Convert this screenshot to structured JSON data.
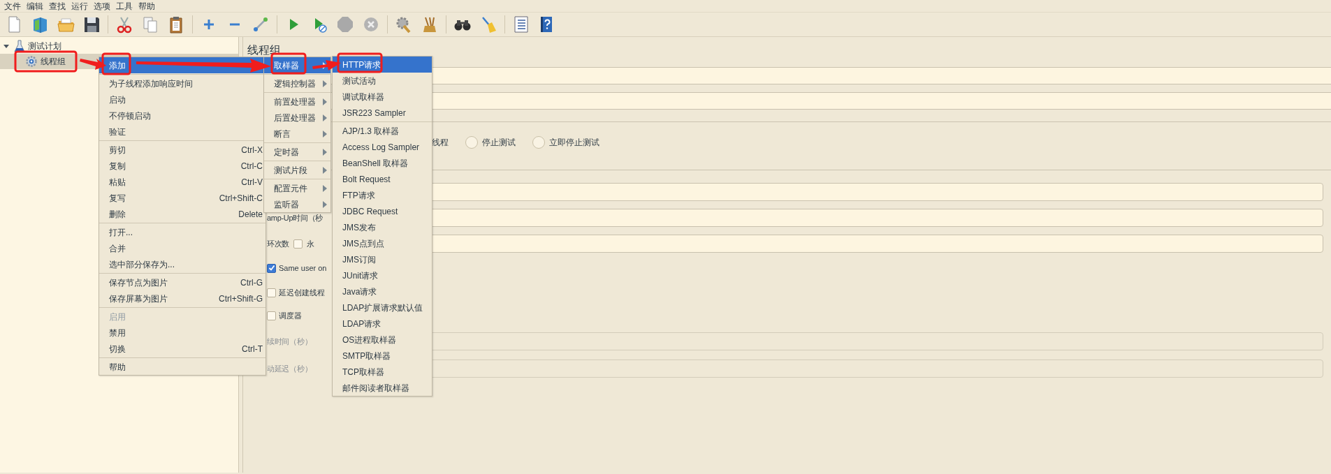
{
  "menubar": [
    {
      "label": "文件"
    },
    {
      "label": "编辑"
    },
    {
      "label": "查找"
    },
    {
      "label": "运行"
    },
    {
      "label": "选项"
    },
    {
      "label": "工具"
    },
    {
      "label": "帮助"
    }
  ],
  "tree": [
    {
      "label": "测试计划",
      "expanded": true,
      "selected": false,
      "children": [
        {
          "label": "线程组",
          "selected": true
        }
      ]
    }
  ],
  "panel": {
    "title": "线程组",
    "rows": [
      {
        "kind": "wide_field"
      },
      {
        "kind": "wide_field"
      },
      {
        "kind": "radios",
        "lead": "线程",
        "options": [
          {
            "label": "停止测试",
            "selected": false
          },
          {
            "label": "立即停止测试",
            "selected": false
          }
        ]
      },
      {
        "kind": "field"
      },
      {
        "kind": "field",
        "label": "amp-Up时间（秒"
      },
      {
        "kind": "field",
        "label": "环次数",
        "check": {
          "label": "永",
          "checked": false
        }
      },
      {
        "kind": "check",
        "label": "Same user on",
        "checked": true
      },
      {
        "kind": "check",
        "label": "延迟创建线程",
        "checked": false
      },
      {
        "kind": "check",
        "label": "调度器",
        "checked": false
      },
      {
        "kind": "field",
        "label": "续时间（秒）",
        "disabled": true
      },
      {
        "kind": "field",
        "label": "动延迟（秒）",
        "disabled": true
      }
    ]
  },
  "context_menu": {
    "groups": [
      [
        {
          "label": "添加",
          "selected": true,
          "disabled": false
        }
      ],
      [
        {
          "label": "为子线程添加响应时间",
          "selected": false,
          "disabled": false
        },
        {
          "label": "启动",
          "selected": false,
          "disabled": false
        },
        {
          "label": "不停顿启动",
          "selected": false,
          "disabled": false
        },
        {
          "label": "验证",
          "selected": false,
          "disabled": false
        }
      ],
      [
        {
          "label": "剪切",
          "shortcut": "Ctrl-X",
          "selected": false,
          "disabled": false
        },
        {
          "label": "复制",
          "shortcut": "Ctrl-C",
          "selected": false,
          "disabled": false
        },
        {
          "label": "粘贴",
          "shortcut": "Ctrl-V",
          "selected": false,
          "disabled": false
        },
        {
          "label": "复写",
          "shortcut": "Ctrl+Shift-C",
          "selected": false,
          "disabled": false
        },
        {
          "label": "删除",
          "shortcut": "Delete",
          "selected": false,
          "disabled": false
        }
      ],
      [
        {
          "label": "打开...",
          "selected": false,
          "disabled": false
        },
        {
          "label": "合并",
          "selected": false,
          "disabled": false
        },
        {
          "label": "选中部分保存为...",
          "selected": false,
          "disabled": false
        }
      ],
      [
        {
          "label": "保存节点为图片",
          "shortcut": "Ctrl-G",
          "selected": false,
          "disabled": false
        },
        {
          "label": "保存屏幕为图片",
          "shortcut": "Ctrl+Shift-G",
          "selected": false,
          "disabled": false
        }
      ],
      [
        {
          "label": "启用",
          "selected": false,
          "disabled": true
        },
        {
          "label": "禁用",
          "selected": false,
          "disabled": false
        },
        {
          "label": "切换",
          "shortcut": "Ctrl-T",
          "selected": false,
          "disabled": false
        }
      ],
      [
        {
          "label": "帮助",
          "selected": false,
          "disabled": false
        }
      ]
    ]
  },
  "add_menu": {
    "groups": [
      [
        {
          "label": "取样器",
          "selected": true,
          "submenu": true
        }
      ],
      [
        {
          "label": "逻辑控制器",
          "selected": false,
          "submenu": true
        }
      ],
      [
        {
          "label": "前置处理器",
          "selected": false,
          "submenu": true
        },
        {
          "label": "后置处理器",
          "selected": false,
          "submenu": true
        },
        {
          "label": "断言",
          "selected": false,
          "submenu": true
        }
      ],
      [
        {
          "label": "定时器",
          "selected": false,
          "submenu": true
        }
      ],
      [
        {
          "label": "测试片段",
          "selected": false,
          "submenu": true
        }
      ],
      [
        {
          "label": "配置元件",
          "selected": false,
          "submenu": true
        },
        {
          "label": "监听器",
          "selected": false,
          "submenu": true
        }
      ]
    ]
  },
  "sampler_menu": {
    "groups": [
      [
        {
          "label": "HTTP请求",
          "selected": true
        },
        {
          "label": "测试活动",
          "selected": false
        },
        {
          "label": "调试取样器",
          "selected": false
        },
        {
          "label": "JSR223 Sampler",
          "selected": false
        }
      ],
      [
        {
          "label": "AJP/1.3 取样器",
          "selected": false
        },
        {
          "label": "Access Log Sampler",
          "selected": false
        },
        {
          "label": "BeanShell 取样器",
          "selected": false
        },
        {
          "label": "Bolt Request",
          "selected": false
        },
        {
          "label": "FTP请求",
          "selected": false
        },
        {
          "label": "JDBC Request",
          "selected": false
        },
        {
          "label": "JMS发布",
          "selected": false
        },
        {
          "label": "JMS点到点",
          "selected": false
        },
        {
          "label": "JMS订阅",
          "selected": false
        },
        {
          "label": "JUnit请求",
          "selected": false
        },
        {
          "label": "Java请求",
          "selected": false
        },
        {
          "label": "LDAP扩展请求默认值",
          "selected": false
        },
        {
          "label": "LDAP请求",
          "selected": false
        },
        {
          "label": "OS进程取样器",
          "selected": false
        },
        {
          "label": "SMTP取样器",
          "selected": false
        },
        {
          "label": "TCP取样器",
          "selected": false
        },
        {
          "label": "邮件阅读者取样器",
          "selected": false
        }
      ]
    ]
  }
}
